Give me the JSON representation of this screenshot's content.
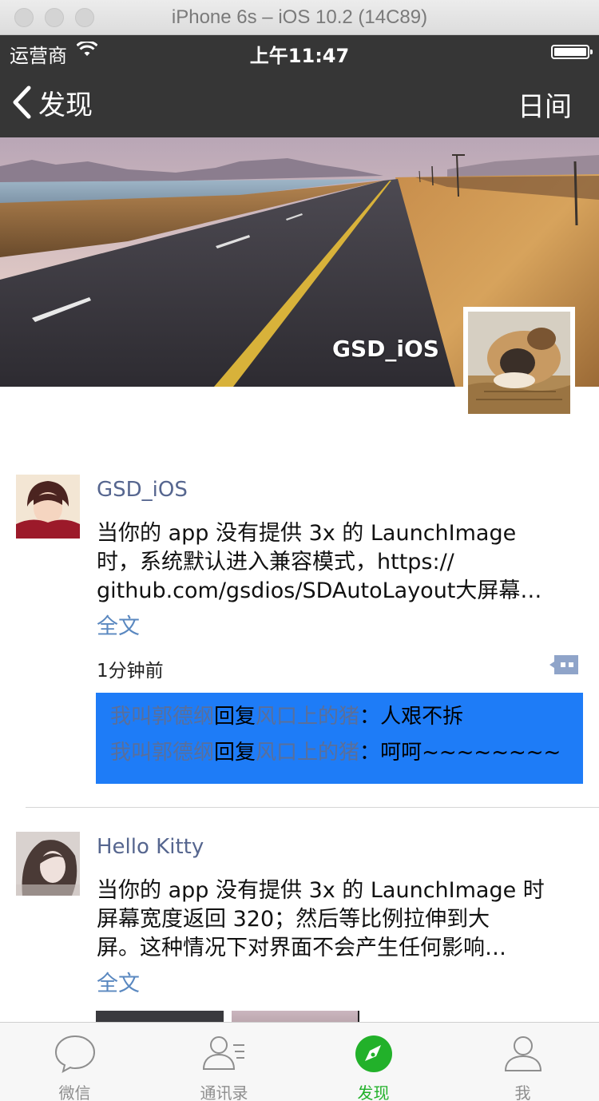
{
  "window": {
    "title": "iPhone 6s – iOS 10.2 (14C89)"
  },
  "statusbar": {
    "carrier": "运营商",
    "time": "上午11:47"
  },
  "navbar": {
    "back_label": "发现",
    "right_label": "日间"
  },
  "profile": {
    "name": "GSD_iOS"
  },
  "posts": [
    {
      "author": "GSD_iOS",
      "content": "当你的 app 没有提供 3x 的 LaunchImage 时，系统默认进入兼容模式，https://github.com/gsdios/SDAutoLayout大屏幕…",
      "lines": [
        "当你的 app 没有提供 3x 的 LaunchImage",
        "时，系统默认进入兼容模式，https://",
        "github.com/gsdios/SDAutoLayout大屏幕…"
      ],
      "fulltext": "全文",
      "time": "1分钟前",
      "comments": [
        {
          "from": "我叫郭德纲",
          "verb": "回复",
          "to": "风口上的猪",
          "sep": "：",
          "text": "人艰不拆"
        },
        {
          "from": "我叫郭德纲",
          "verb": "回复",
          "to": "风口上的猪",
          "sep": "：",
          "text": "呵呵~~~~~~~~"
        }
      ]
    },
    {
      "author": "Hello Kitty",
      "lines": [
        "当你的 app 没有提供 3x 的 LaunchImage 时",
        "屏幕宽度返回 320；然后等比例拉伸到大",
        "屏。这种情况下对界面不会产生任何影响…"
      ],
      "fulltext": "全文"
    }
  ],
  "tabbar": {
    "items": [
      {
        "label": "微信",
        "icon": "chat-bubble-icon"
      },
      {
        "label": "通讯录",
        "icon": "contacts-icon"
      },
      {
        "label": "发现",
        "icon": "compass-icon",
        "active": true
      },
      {
        "label": "我",
        "icon": "person-icon"
      }
    ]
  },
  "colors": {
    "navbar": "#363636",
    "link_blue": "#56668f",
    "comment_bg": "#1e7cf7",
    "tab_active": "#22b12a"
  }
}
